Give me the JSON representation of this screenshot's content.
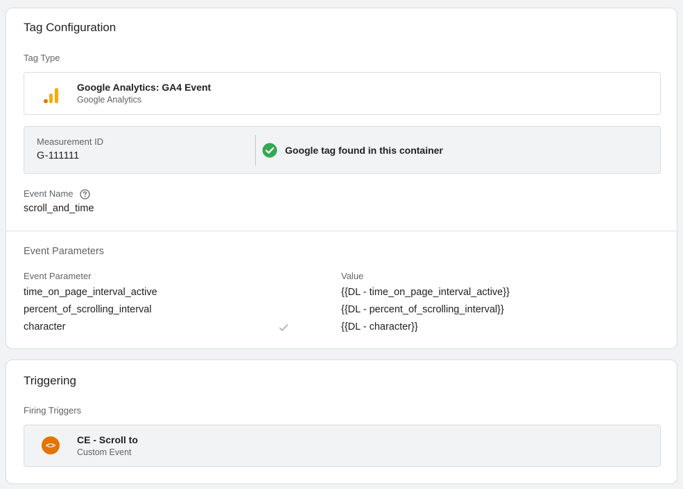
{
  "tag_configuration": {
    "title": "Tag Configuration",
    "tag_type_label": "Tag Type",
    "tag_type": {
      "icon": "google-analytics-icon",
      "name": "Google Analytics: GA4 Event",
      "subtitle": "Google Analytics"
    },
    "measurement": {
      "label": "Measurement ID",
      "value": "G-111111",
      "status_icon": "check-circle-icon",
      "status_text": "Google tag found in this container",
      "status_color": "#34a853"
    },
    "event_name": {
      "label": "Event Name",
      "help_icon": "help-circle-icon",
      "value": "scroll_and_time"
    },
    "event_parameters": {
      "title": "Event Parameters",
      "column_parameter": "Event Parameter",
      "column_value": "Value",
      "rows": [
        {
          "parameter": "time_on_page_interval_active",
          "value": "{{DL - time_on_page_interval_active}}"
        },
        {
          "parameter": "percent_of_scrolling_interval",
          "value": "{{DL - percent_of_scrolling_interval}}"
        },
        {
          "parameter": "character",
          "value": "{{DL - character}}",
          "icon": "checkmark-icon"
        }
      ]
    }
  },
  "triggering": {
    "title": "Triggering",
    "firing_triggers_label": "Firing Triggers",
    "trigger": {
      "icon": "custom-event-code-icon",
      "icon_glyph": "<>",
      "icon_color": "#e37400",
      "name": "CE - Scroll to",
      "subtitle": "Custom Event"
    }
  }
}
